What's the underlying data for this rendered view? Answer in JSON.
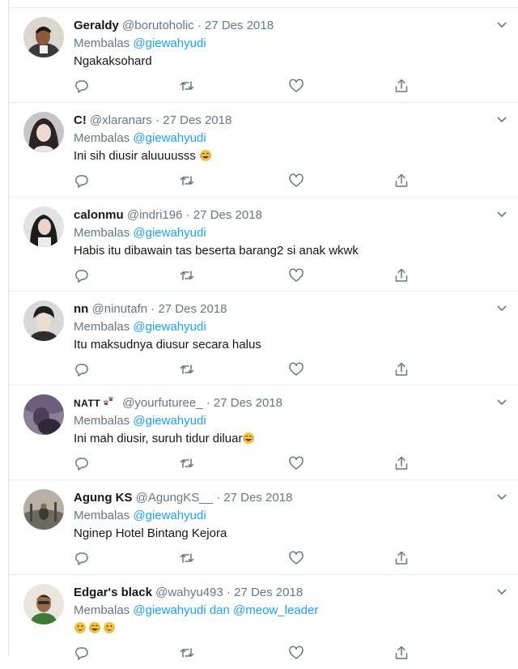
{
  "colors": {
    "accent": "#1da1f2",
    "muted": "#657786",
    "text": "#14171a",
    "border": "#e6ecf0"
  },
  "replying_prefix": "Membalas",
  "replies": [
    {
      "name": "Geraldy",
      "handle": "@borutoholic",
      "sep": "·",
      "date": "27 Des 2018",
      "mention": "@giewahyudi",
      "text": "Ngakaksohard"
    },
    {
      "name": "C!",
      "handle": "@xlaranars",
      "sep": "·",
      "date": "27 Des 2018",
      "mention": "@giewahyudi",
      "text": "Ini sih diusir aluuuusss",
      "emoji_after": [
        "face-tears-of-joy"
      ]
    },
    {
      "name": "calonmu",
      "handle": "@indri196",
      "sep": "·",
      "date": "27 Des 2018",
      "mention": "@giewahyudi",
      "text": "Habis itu dibawain tas beserta barang2 si anak wkwk"
    },
    {
      "name": "nn",
      "handle": "@ninutafn",
      "sep": "·",
      "date": "27 Des 2018",
      "mention": "@giewahyudi",
      "text": "Itu maksudnya diusur secara halus"
    },
    {
      "name": "NATT",
      "name_icon": "paw-prints-icon",
      "handle": "@yourfuturee_",
      "sep": "·",
      "date": "27 Des 2018",
      "mention": "@giewahyudi",
      "text": "Ini mah diusir, suruh tidur diluar",
      "emoji_after": [
        "face-tears-of-joy"
      ]
    },
    {
      "name": "Agung KS",
      "handle": "@AgungKS__",
      "sep": "·",
      "date": "27 Des 2018",
      "mention": "@giewahyudi",
      "text": "Nginep Hotel Bintang Kejora"
    },
    {
      "name": "Edgar's black",
      "handle": "@wahyu493",
      "sep": "·",
      "date": "27 Des 2018",
      "mention": "@giewahyudi",
      "mention_joiner": "dan",
      "mention2": "@meow_leader",
      "text": "",
      "emoji_after": [
        "grinning-face",
        "face-tears-of-joy",
        "grinning-face"
      ]
    }
  ]
}
